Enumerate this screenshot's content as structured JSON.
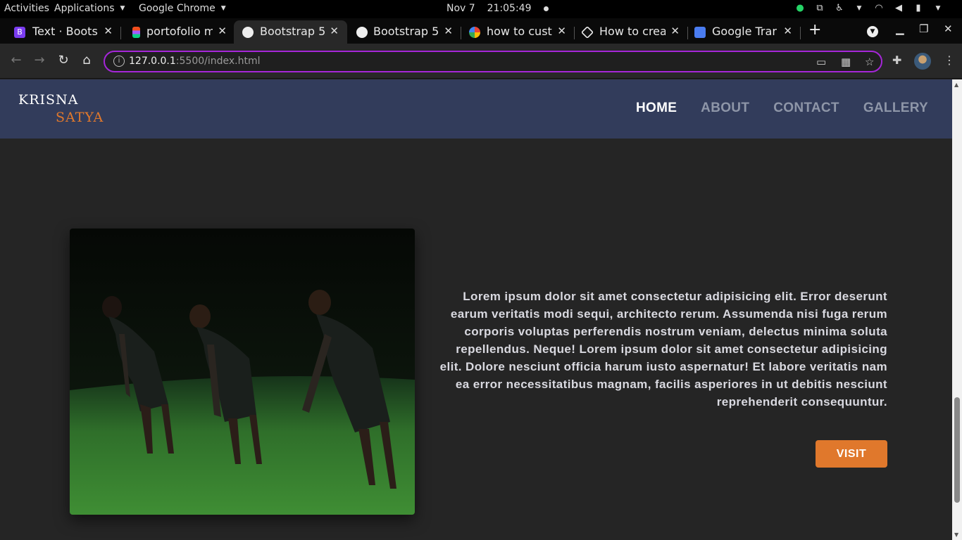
{
  "system": {
    "activities": "Activities",
    "applications": "Applications",
    "app_name": "Google Chrome",
    "date": "Nov 7",
    "time": "21:05:49"
  },
  "tabs": [
    {
      "title": "Text · Boots",
      "favicon_color": "#7a3cf0",
      "active": false
    },
    {
      "title": "portofolio m",
      "favicon_color": "#f24e1e",
      "active": false
    },
    {
      "title": "Bootstrap 5",
      "favicon_color": "#eeeeee",
      "active": true
    },
    {
      "title": "Bootstrap 5",
      "favicon_color": "#eeeeee",
      "active": false
    },
    {
      "title": "how to cust",
      "favicon_color": "#4285f4",
      "active": false
    },
    {
      "title": "How to crea",
      "favicon_color": "#eeeeee",
      "active": false
    },
    {
      "title": "Google Trar",
      "favicon_color": "#4a7cf0",
      "active": false
    }
  ],
  "toolbar": {
    "url_host": "127.0.0.1",
    "url_path": ":5500/index.html"
  },
  "site": {
    "logo_line1": "KRISNA",
    "logo_line2": "SATYA",
    "nav": [
      {
        "label": "HOME",
        "active": true
      },
      {
        "label": "ABOUT",
        "active": false
      },
      {
        "label": "CONTACT",
        "active": false
      },
      {
        "label": "GALLERY",
        "active": false
      }
    ],
    "body_text": "Lorem ipsum dolor sit amet consectetur adipisicing elit. Error deserunt earum veritatis modi sequi, architecto rerum. Assumenda nisi fuga rerum corporis voluptas perferendis nostrum veniam, delectus minima soluta repellendus. Neque! Lorem ipsum dolor sit amet consectetur adipisicing elit. Dolore nesciunt officia harum iusto aspernatur! Et labore veritatis nam ea error necessitatibus magnam, facilis asperiores in ut debitis nesciunt reprehenderit consequuntur.",
    "visit_label": "VISIT"
  },
  "colors": {
    "nav_bg": "#323c5b",
    "accent": "#e0782c",
    "page_bg": "#252525",
    "omnibox_border": "#a526d8"
  }
}
